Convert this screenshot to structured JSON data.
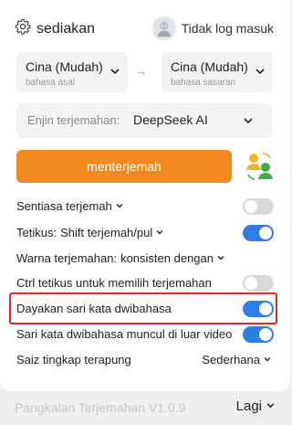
{
  "header": {
    "settings_label": "sediakan",
    "login_label": "Tidak log masuk"
  },
  "languages": {
    "source": {
      "name": "Cina (Mudah)",
      "caption": "bahasa asal"
    },
    "target": {
      "name": "Cina (Mudah)",
      "caption": "bahasa sasaran"
    },
    "swap_symbol": "→"
  },
  "engine": {
    "label": "Enjin terjemahan:",
    "value": "DeepSeek AI"
  },
  "translate_button": "menterjemah",
  "settings": [
    {
      "label": "Sentiasa terjemah",
      "enabled": false
    },
    {
      "label": "Tetikus:",
      "value": "Shift terjemah/pul",
      "enabled": true
    },
    {
      "label": "Warna terjemahan:",
      "value": "konsisten dengan"
    },
    {
      "label": "Ctrl tetikus untuk memilih terjemahan",
      "enabled": false
    },
    {
      "label": "Dayakan sari kata dwibahasa",
      "enabled": true
    },
    {
      "label": "Sari kata dwibahasa muncul di luar video",
      "enabled": true
    },
    {
      "label": "Saiz tingkap terapung",
      "value": "Sederhana"
    }
  ],
  "footer": {
    "version": "Pangkalan Terjemahan V1.0.9",
    "more_label": "Lagi"
  },
  "colors": {
    "accent": "#f28a20",
    "toggle_on": "#2f7ee6",
    "toggle_off": "#d9d9d9",
    "highlight": "#e0262a"
  }
}
